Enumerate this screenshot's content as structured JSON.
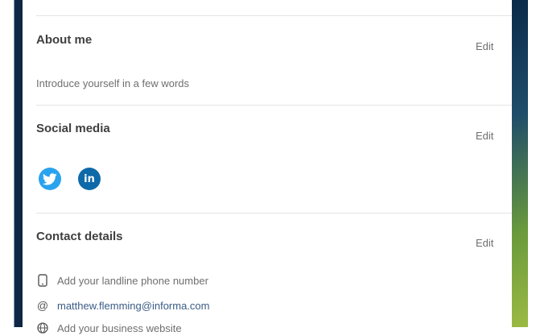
{
  "about": {
    "title": "About me",
    "edit_label": "Edit",
    "placeholder": "Introduce yourself in a few words"
  },
  "social": {
    "title": "Social media",
    "edit_label": "Edit",
    "icons": [
      "twitter-icon",
      "linkedin-icon"
    ],
    "linkedin_glyph": "in",
    "colors": {
      "twitter": "#2aa3ef",
      "linkedin": "#0e69a9"
    }
  },
  "contact": {
    "title": "Contact details",
    "edit_label": "Edit",
    "landline": "Add your landline phone number",
    "email_symbol": "@",
    "email": "matthew.flemming@informa.com",
    "website": "Add your business website"
  }
}
